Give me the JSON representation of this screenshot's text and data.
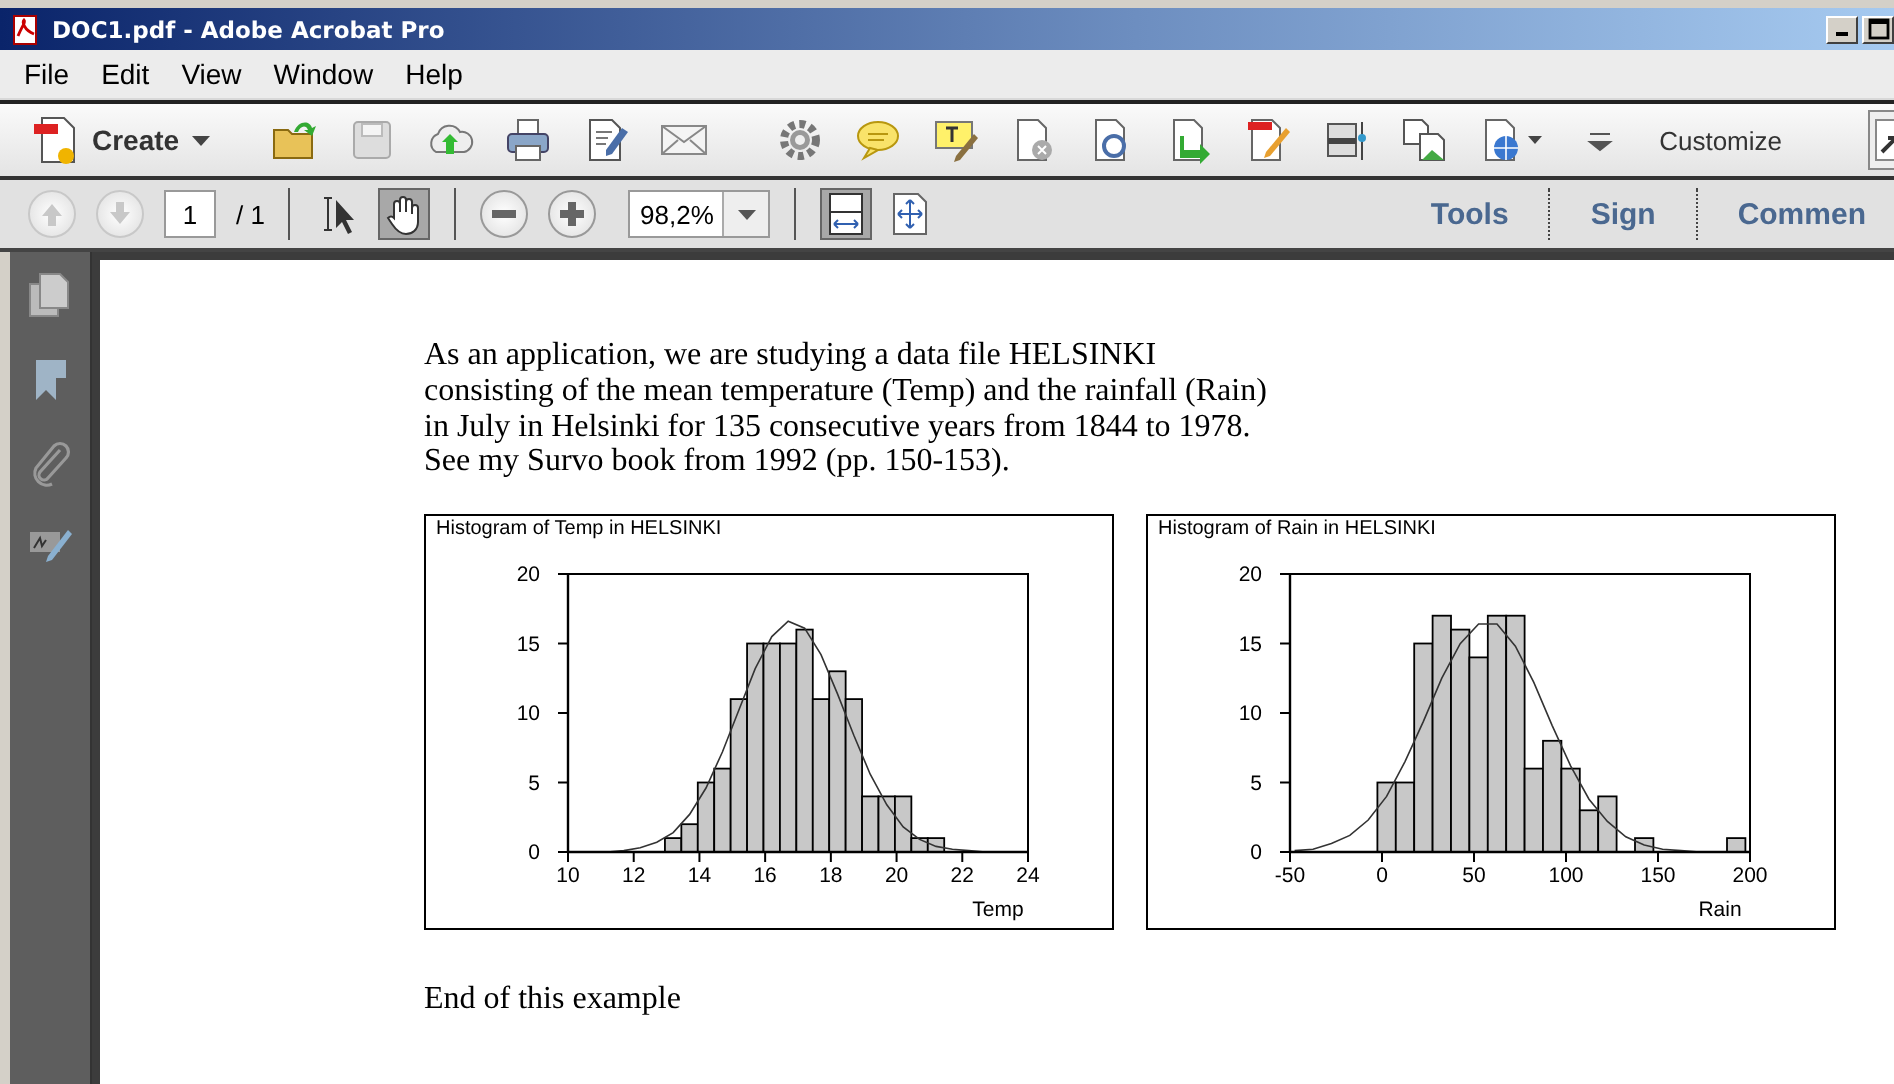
{
  "window": {
    "title": "DOC1.pdf - Adobe Acrobat Pro"
  },
  "menu": [
    "File",
    "Edit",
    "View",
    "Window",
    "Help"
  ],
  "toolbar": {
    "create": "Create",
    "customize": "Customize"
  },
  "nav": {
    "page": "1",
    "page_total": "/ 1",
    "zoom": "98,2%",
    "tools": [
      {
        "kind": "select",
        "selected": false
      },
      {
        "kind": "hand",
        "selected": true
      }
    ],
    "views": [
      {
        "kind": "fit-width",
        "selected": true
      },
      {
        "kind": "fit-page",
        "selected": false
      }
    ]
  },
  "panes": [
    "Tools",
    "Sign",
    "Commen"
  ],
  "document": {
    "paragraph": "As an application, we are studying a data file HELSINKI\nconsisting of the mean temperature (Temp) and the rainfall (Rain)\nin July in Helsinki for 135 consecutive years from 1844 to 1978.\nSee my Survo book from 1992 (pp. 150-153).",
    "charts": [
      {
        "chart_data": {
          "type": "bar",
          "title": "Histogram of Temp in HELSINKI",
          "xlabel": "Temp",
          "x": [
            10.2,
            10.7,
            11.2,
            11.7,
            12.2,
            12.7,
            13.2,
            13.7,
            14.2,
            14.7,
            15.2,
            15.7,
            16.2,
            16.7,
            17.2,
            17.7,
            18.2,
            18.7,
            19.2,
            19.7,
            20.2,
            20.7,
            21.2,
            21.7,
            22.2,
            22.7,
            23.2,
            23.7
          ],
          "series": [
            {
              "type": "bar",
              "color": "#c8c8c8",
              "values": [
                null,
                null,
                null,
                null,
                null,
                null,
                1,
                2,
                5,
                6,
                11,
                15,
                15,
                15,
                16,
                11,
                13,
                11,
                4,
                4,
                4,
                1,
                1,
                null,
                null,
                null,
                null,
                null
              ]
            },
            {
              "type": "line",
              "color": "#333333",
              "values": [
                0.0,
                0.0,
                0.0,
                0.1,
                0.3,
                0.7,
                1.4,
                2.7,
                4.6,
                7.2,
                10.2,
                13.2,
                15.5,
                16.6,
                16.1,
                14.2,
                11.4,
                8.4,
                5.6,
                3.4,
                1.8,
                0.9,
                0.4,
                0.2,
                0.1,
                0.0,
                0.0,
                0.0
              ]
            }
          ],
          "xlim": [
            10,
            24
          ],
          "ylim": [
            0,
            20
          ],
          "xticks": [
            10,
            12,
            14,
            16,
            18,
            20,
            22,
            24
          ],
          "yticks": [
            0,
            5,
            10,
            15,
            20
          ]
        }
      },
      {
        "chart_data": {
          "type": "bar",
          "title": "Histogram of Rain in HELSINKI",
          "xlabel": "Rain",
          "x": [
            -47.5,
            -37.5,
            -27.5,
            -17.5,
            -7.5,
            2.5,
            12.5,
            22.5,
            32.5,
            42.5,
            52.5,
            62.5,
            72.5,
            82.5,
            92.5,
            102.5,
            112.5,
            122.5,
            132.5,
            142.5,
            152.5,
            162.5,
            172.5,
            182.5,
            192.5
          ],
          "series": [
            {
              "type": "bar",
              "color": "#c8c8c8",
              "values": [
                null,
                null,
                null,
                null,
                null,
                5,
                5,
                15,
                17,
                16,
                14,
                17,
                17,
                6,
                8,
                6,
                3,
                4,
                null,
                1,
                null,
                null,
                null,
                null,
                1
              ]
            },
            {
              "type": "line",
              "color": "#333333",
              "values": [
                0.1,
                0.2,
                0.6,
                1.2,
                2.3,
                4.0,
                6.5,
                9.4,
                12.5,
                15.0,
                16.4,
                16.4,
                14.8,
                12.2,
                9.1,
                6.2,
                3.8,
                2.2,
                1.1,
                0.5,
                0.2,
                0.1,
                0.0,
                0.0,
                0.0
              ]
            }
          ],
          "xlim": [
            -50,
            200
          ],
          "ylim": [
            0,
            20
          ],
          "xticks": [
            -50,
            0,
            50,
            100,
            150,
            200
          ],
          "yticks": [
            0,
            5,
            10,
            15,
            20
          ]
        }
      }
    ],
    "footer": "End of this example"
  }
}
